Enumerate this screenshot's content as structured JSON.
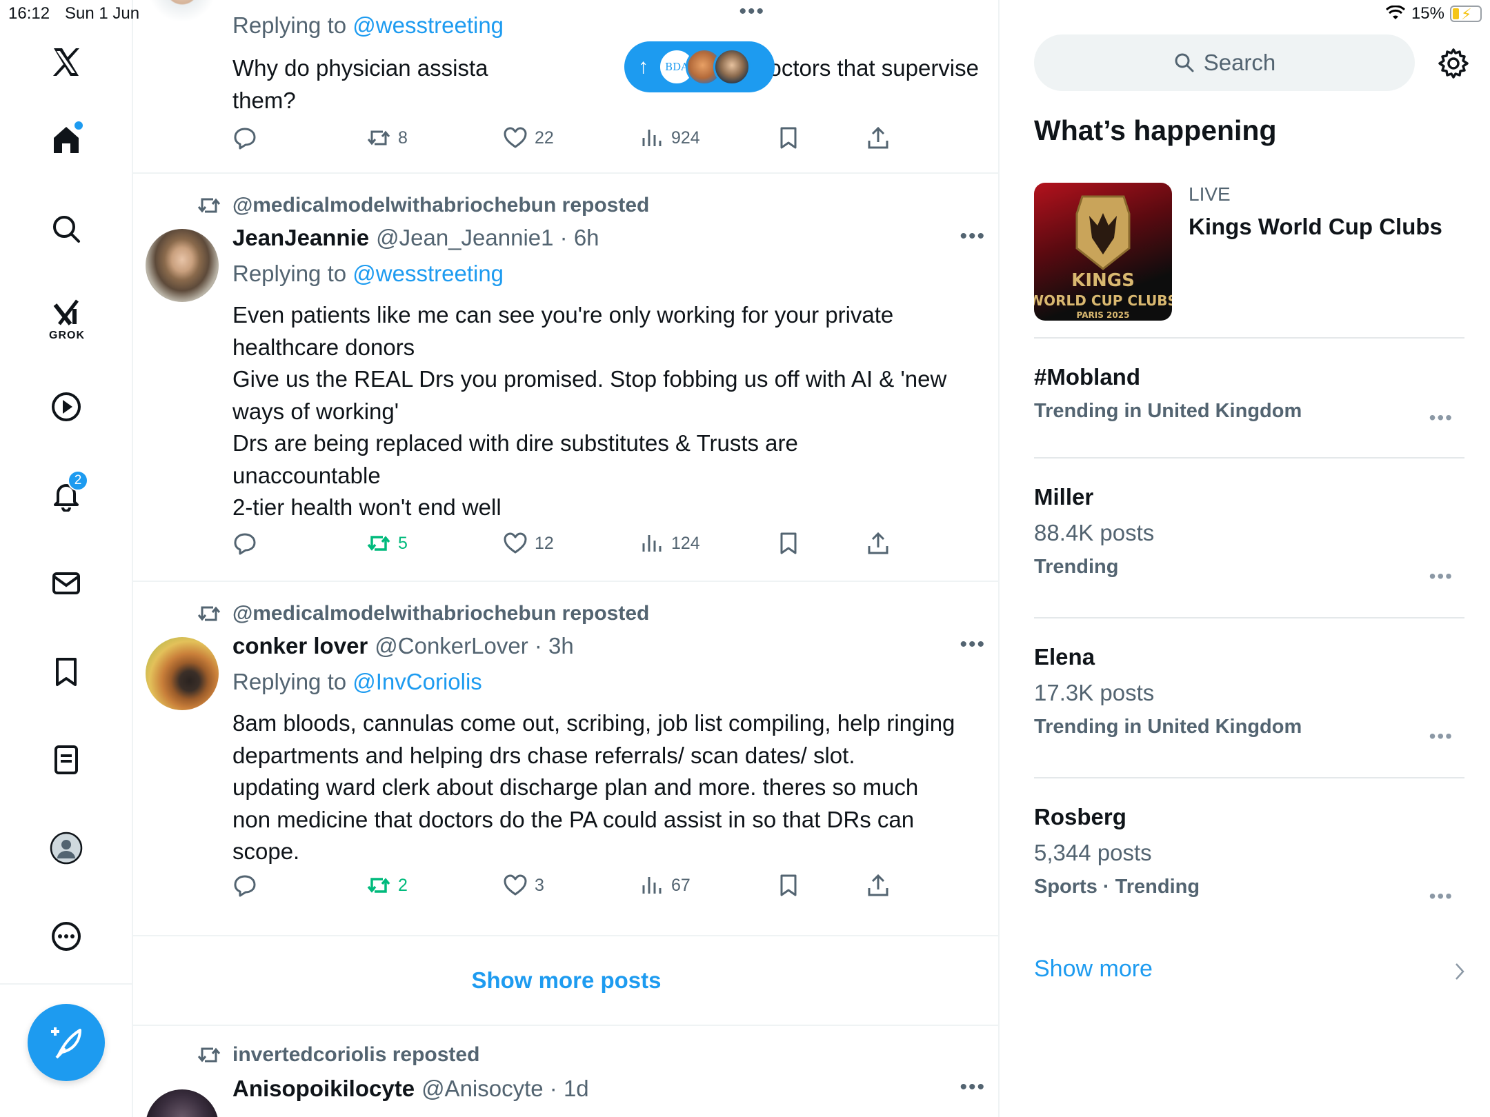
{
  "status": {
    "time": "16:12",
    "date": "Sun 1 Jun",
    "battery": "15%"
  },
  "nav": {
    "grok_label": "GROK",
    "notifications_count": "2"
  },
  "floating_pill": {
    "avatar_text": "BDA"
  },
  "posts": [
    {
      "replying_prefix": "Replying to ",
      "replying_to": "@wesstreeting",
      "body_lines": [
        "Why do physician assista",
        "than the doctors that supervise",
        "them?"
      ],
      "replies": "",
      "reposts": "8",
      "likes": "22",
      "views": "924"
    },
    {
      "reposted_by": "@medicalmodelwithabriochebun reposted",
      "name": "JeanJeannie",
      "handle": "@Jean_Jeannie1 · 6h",
      "replying_prefix": "Replying to ",
      "replying_to": "@wesstreeting",
      "body_lines": [
        "Even patients like me can see you're only working for your private",
        "healthcare donors",
        "Give us the REAL Drs you promised. Stop fobbing us off with AI & 'new",
        "ways of working'",
        "Drs are being replaced with dire substitutes  & Trusts are",
        "unaccountable",
        "2-tier health won't end well"
      ],
      "reposts": "5",
      "likes": "12",
      "views": "124"
    },
    {
      "reposted_by": "@medicalmodelwithabriochebun reposted",
      "name": "conker lover",
      "handle": "@ConkerLover · 3h",
      "replying_prefix": "Replying to ",
      "replying_to": "@InvCoriolis",
      "body_lines": [
        "8am bloods, cannulas come out, scribing, job list compiling, help ringing",
        "departments and helping drs chase referrals/ scan dates/ slot.",
        "updating ward clerk about discharge plan and more. theres so much",
        "non medicine that doctors do the PA could assist in so that DRs can",
        "scope."
      ],
      "reposts": "2",
      "likes": "3",
      "views": "67"
    },
    {
      "reposted_by": "invertedcoriolis reposted",
      "name": "Anisopoikilocyte",
      "handle": "@Anisocyte · 1d"
    }
  ],
  "show_more_posts": "Show more posts",
  "right": {
    "search_placeholder": "Search",
    "section_title": "What’s happening",
    "live": {
      "label": "LIVE",
      "title": "Kings World Cup Clubs",
      "thumb_line1": "KINGS",
      "thumb_line2": "WORLD CUP CLUBS",
      "thumb_line3": "PARIS 2025"
    },
    "trends": [
      {
        "name": "#Mobland",
        "posts": "",
        "meta": "Trending in United Kingdom"
      },
      {
        "name": "Miller",
        "posts": "88.4K posts",
        "meta": "Trending"
      },
      {
        "name": "Elena",
        "posts": "17.3K posts",
        "meta": "Trending in United Kingdom"
      },
      {
        "name": "Rosberg",
        "posts": "5,344 posts",
        "meta": "Sports · Trending"
      }
    ],
    "show_more": "Show more"
  },
  "colors": {
    "accent": "#1d9bf0",
    "repost_active": "#00ba7c",
    "muted": "#536471"
  }
}
